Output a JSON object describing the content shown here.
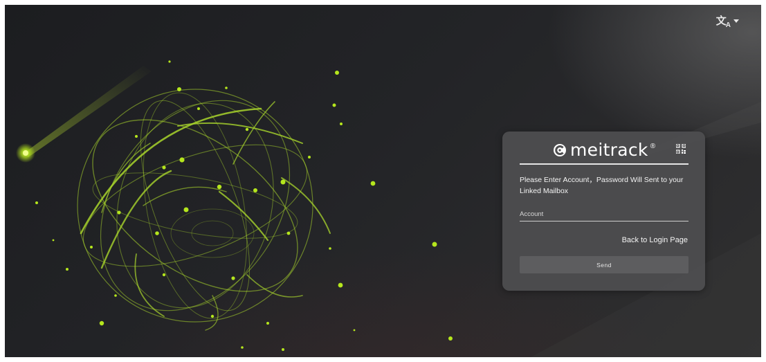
{
  "header": {
    "language_icon": "translate-icon",
    "language_dropdown_icon": "caret-down-icon",
    "language_glyph": "文",
    "language_glyph_sub": "A"
  },
  "card": {
    "brand": {
      "logo_icon": "meitrack-logo-icon",
      "name": "meitrack",
      "registered_mark": "®"
    },
    "qr_icon": "qr-code-icon",
    "instruction": "Please Enter Account，Password Will Sent to your Linked Mailbox",
    "account": {
      "placeholder": "Account",
      "value": ""
    },
    "back_link": "Back to Login Page",
    "send_label": "Send"
  },
  "colors": {
    "accent": "#b5e61d",
    "background_dark": "#1c1d20",
    "card": "#4e4e50",
    "button": "#5d5d5f",
    "text": "#f4f4f4"
  }
}
